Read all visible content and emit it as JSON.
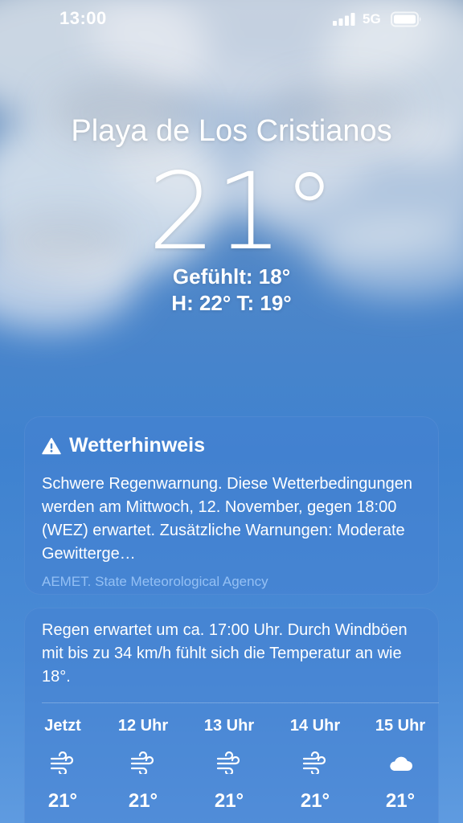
{
  "status_bar": {
    "time": "13:00",
    "network": "5G"
  },
  "weather": {
    "location": "Playa de Los Cristianos",
    "temperature": "21°",
    "feels_like": "Gefühlt: 18°",
    "high_low": "H: 22°  T: 19°"
  },
  "alert": {
    "title": "Wetterhinweis",
    "body": "Schwere Regenwarnung. Diese Wetter­bedingungen werden am Mittwoch, 12. November, gegen 18:00 (WEZ) erwartet. Zusätzliche Warnungen: Moderate Gewitterge…",
    "source": "AEMET. State Meteorological Agency"
  },
  "forecast": {
    "summary": "Regen erwartet um ca. 17:00 Uhr. Durch Windböen mit bis zu 34 km/h fühlt sich die Temperatur an wie 18°.",
    "hours": [
      {
        "label": "Jetzt",
        "icon": "wind-icon",
        "temp": "21°"
      },
      {
        "label": "12 Uhr",
        "icon": "wind-icon",
        "temp": "21°"
      },
      {
        "label": "13 Uhr",
        "icon": "wind-icon",
        "temp": "21°"
      },
      {
        "label": "14 Uhr",
        "icon": "wind-icon",
        "temp": "21°"
      },
      {
        "label": "15 Uhr",
        "icon": "cloud-icon",
        "temp": "21°"
      }
    ]
  }
}
